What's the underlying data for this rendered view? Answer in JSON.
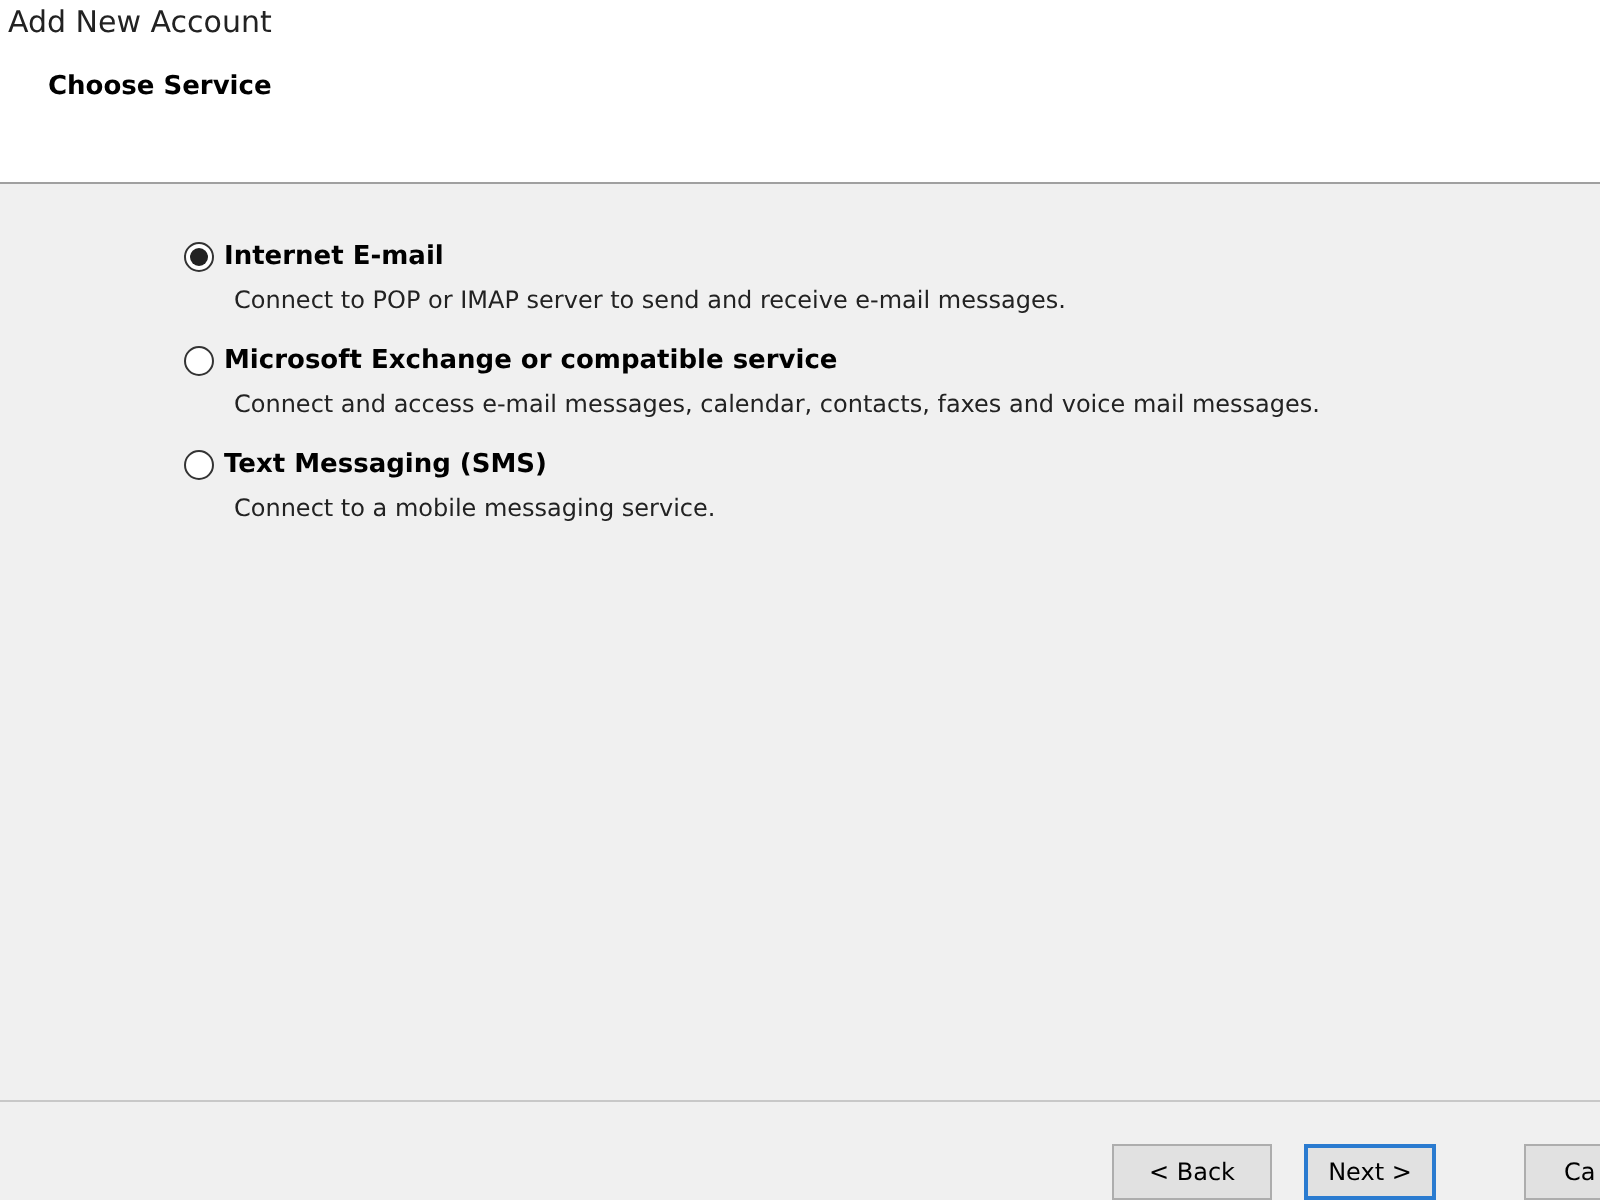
{
  "window": {
    "title": "Add New Account"
  },
  "header": {
    "title": "Choose Service"
  },
  "options": [
    {
      "label": "Internet E-mail",
      "description": "Connect to POP or IMAP server to send and receive e-mail messages.",
      "selected": true
    },
    {
      "label": "Microsoft Exchange or compatible service",
      "description": "Connect and access e-mail messages, calendar, contacts, faxes and voice mail messages.",
      "selected": false
    },
    {
      "label": "Text Messaging (SMS)",
      "description": "Connect to a mobile messaging service.",
      "selected": false
    }
  ],
  "buttons": [
    {
      "label": "< Back",
      "kind": "normal"
    },
    {
      "label": "Next >",
      "kind": "default"
    },
    {
      "label": "Ca",
      "kind": "cut"
    }
  ]
}
